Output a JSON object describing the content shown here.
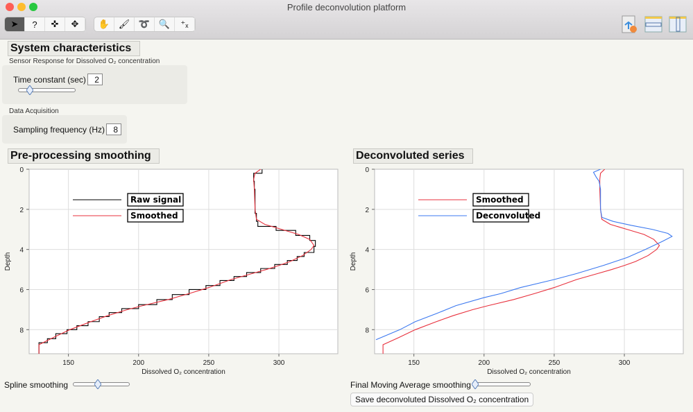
{
  "window": {
    "title": "Profile deconvolution platform"
  },
  "toolbar": {
    "tools": [
      {
        "icon": "arrow-icon",
        "glyph": "➤"
      },
      {
        "icon": "help-icon",
        "glyph": "?"
      },
      {
        "icon": "crosshair-icon",
        "glyph": "✜"
      },
      {
        "icon": "move-icon",
        "glyph": "✥"
      }
    ],
    "tools2": [
      {
        "icon": "hand-icon",
        "glyph": "✋"
      },
      {
        "icon": "brush-icon",
        "glyph": "🖌"
      },
      {
        "icon": "lasso-icon",
        "glyph": "➰"
      },
      {
        "icon": "magnifier-icon",
        "glyph": "🔍"
      },
      {
        "icon": "crosshair-xy-icon",
        "glyph": "⁺ₓ"
      }
    ]
  },
  "system": {
    "title": "System characteristics",
    "sensor_label": "Sensor Response for Dissolved O₂ concentration",
    "time_constant_label": "Time constant (sec)",
    "time_constant": "2",
    "time_slider_fraction": 0.18,
    "acq_label": "Data Acquisition",
    "sampling_label": "Sampling frequency (Hz)",
    "sampling": "8"
  },
  "left": {
    "title": "Pre-processing smoothing",
    "slider_label": "Spline smoothing",
    "slider_fraction": 0.45
  },
  "right": {
    "title": "Deconvoluted series",
    "slider_label": "Final Moving Average smoothing",
    "slider_fraction": 0.0,
    "save_label": "Save deconvoluted Dissolved O₂ concentration"
  },
  "chart_data": [
    {
      "type": "line",
      "xlabel": "Dissolved O₂ concentration",
      "ylabel": "Depth",
      "xlim": [
        122,
        342
      ],
      "ylim": [
        0,
        9.2
      ],
      "y_inverted": true,
      "xticks": [
        150,
        200,
        250,
        300
      ],
      "yticks": [
        0,
        2,
        4,
        6,
        8
      ],
      "grid": true,
      "legend": "top-left",
      "series": [
        {
          "name": "Raw signal",
          "color": "#000000",
          "step": true,
          "points": [
            [
              0,
              288
            ],
            [
              0.2,
              282
            ],
            [
              0.6,
              282.5
            ],
            [
              1.0,
              283
            ],
            [
              1.4,
              283
            ],
            [
              1.8,
              283
            ],
            [
              2.2,
              284
            ],
            [
              2.6,
              285
            ],
            [
              2.85,
              298
            ],
            [
              3.05,
              312
            ],
            [
              3.3,
              322
            ],
            [
              3.55,
              326
            ],
            [
              3.85,
              325
            ],
            [
              4.15,
              318
            ],
            [
              4.35,
              313
            ],
            [
              4.55,
              306
            ],
            [
              4.75,
              297
            ],
            [
              4.95,
              287
            ],
            [
              5.15,
              277
            ],
            [
              5.35,
              268
            ],
            [
              5.55,
              258
            ],
            [
              5.8,
              248
            ],
            [
              6.0,
              236
            ],
            [
              6.25,
              224
            ],
            [
              6.5,
              213
            ],
            [
              6.75,
              200
            ],
            [
              6.95,
              188
            ],
            [
              7.15,
              179
            ],
            [
              7.35,
              172
            ],
            [
              7.6,
              164
            ],
            [
              7.8,
              156
            ],
            [
              8.0,
              149
            ],
            [
              8.2,
              141
            ],
            [
              8.45,
              135
            ],
            [
              8.65,
              129
            ],
            [
              9.2,
              129
            ]
          ]
        },
        {
          "name": "Smoothed",
          "color": "#e8303c",
          "step": false,
          "points": [
            [
              0,
              287
            ],
            [
              0.2,
              283
            ],
            [
              0.5,
              282
            ],
            [
              1,
              282.5
            ],
            [
              2,
              283
            ],
            [
              2.5,
              284
            ],
            [
              2.75,
              290
            ],
            [
              3.0,
              302
            ],
            [
              3.25,
              314
            ],
            [
              3.5,
              322
            ],
            [
              3.8,
              325
            ],
            [
              4.0,
              323
            ],
            [
              4.3,
              317
            ],
            [
              4.6,
              308
            ],
            [
              4.8,
              300
            ],
            [
              5.0,
              291
            ],
            [
              5.2,
              281
            ],
            [
              5.5,
              266
            ],
            [
              5.9,
              250
            ],
            [
              6.2,
              236
            ],
            [
              6.5,
              221
            ],
            [
              6.8,
              203
            ],
            [
              7.0,
              192
            ],
            [
              7.3,
              178
            ],
            [
              7.6,
              166
            ],
            [
              8.0,
              151
            ],
            [
              8.4,
              139
            ],
            [
              8.75,
              129
            ],
            [
              9.2,
              129
            ]
          ]
        }
      ]
    },
    {
      "type": "line",
      "xlabel": "Dissolved O₂ concentration",
      "ylabel": "Depth",
      "xlim": [
        122,
        342
      ],
      "ylim": [
        0,
        9.2
      ],
      "y_inverted": true,
      "xticks": [
        150,
        200,
        250,
        300
      ],
      "yticks": [
        0,
        2,
        4,
        6,
        8
      ],
      "grid": true,
      "legend": "top-left",
      "series": [
        {
          "name": "Smoothed",
          "color": "#e8303c",
          "points": [
            [
              0,
              286
            ],
            [
              0.2,
              283
            ],
            [
              0.5,
              282.5
            ],
            [
              1,
              282.5
            ],
            [
              2,
              283
            ],
            [
              2.5,
              284
            ],
            [
              2.75,
              290
            ],
            [
              3.0,
              302
            ],
            [
              3.25,
              314
            ],
            [
              3.5,
              321
            ],
            [
              3.8,
              325
            ],
            [
              4.0,
              323
            ],
            [
              4.3,
              317
            ],
            [
              4.6,
              308
            ],
            [
              4.8,
              300
            ],
            [
              5.0,
              291
            ],
            [
              5.2,
              281
            ],
            [
              5.5,
              266
            ],
            [
              5.9,
              250
            ],
            [
              6.2,
              236
            ],
            [
              6.5,
              221
            ],
            [
              6.8,
              203
            ],
            [
              7.0,
              192
            ],
            [
              7.3,
              178
            ],
            [
              7.6,
              166
            ],
            [
              8.0,
              151
            ],
            [
              8.4,
              139
            ],
            [
              8.75,
              128
            ],
            [
              9.2,
              128
            ]
          ]
        },
        {
          "name": "Deconvoluted",
          "color": "#3b78f0",
          "points": [
            [
              0,
              283
            ],
            [
              0.15,
              278
            ],
            [
              0.4,
              280
            ],
            [
              0.6,
              282
            ],
            [
              1,
              283
            ],
            [
              2,
              283
            ],
            [
              2.4,
              284
            ],
            [
              2.6,
              292
            ],
            [
              2.8,
              305
            ],
            [
              3.0,
              320
            ],
            [
              3.2,
              331
            ],
            [
              3.35,
              334
            ],
            [
              3.6,
              327
            ],
            [
              4.0,
              315
            ],
            [
              4.4,
              302
            ],
            [
              4.8,
              285
            ],
            [
              5.2,
              266
            ],
            [
              5.5,
              250
            ],
            [
              5.9,
              226
            ],
            [
              6.2,
              212
            ],
            [
              6.4,
              200
            ],
            [
              6.8,
              180
            ],
            [
              7.2,
              166
            ],
            [
              7.6,
              151
            ],
            [
              8.0,
              140
            ],
            [
              8.5,
              123
            ]
          ]
        }
      ]
    }
  ]
}
